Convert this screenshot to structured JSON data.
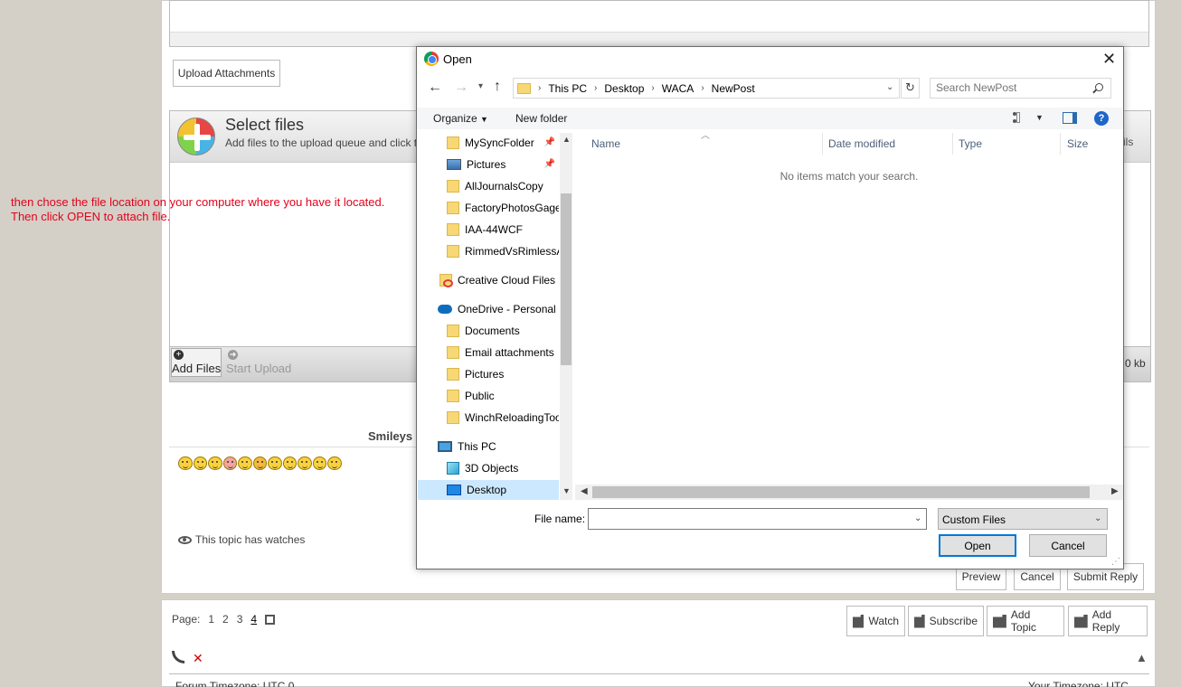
{
  "forum": {
    "upload_attachments": "Upload Attachments",
    "select_files_title": "Select files",
    "select_files_sub": "Add files to the upload queue and click t",
    "column_fragment": "ils",
    "add_files": "Add Files",
    "start_upload": "Start Upload",
    "kb_fragment": "0 kb",
    "instruction": "then chose the file location on your computer where you have it located. Then click OPEN to attach file.",
    "smileys_label": "Smileys",
    "watches_text": "This topic has watches",
    "preview": "Preview",
    "cancel": "Cancel",
    "submit_reply": "Submit Reply",
    "page_label": "Page:",
    "pages": [
      "1",
      "2",
      "3",
      "4"
    ],
    "current_page": "4",
    "tools": {
      "watch": "Watch",
      "subscribe": "Subscribe",
      "add_topic": "Add Topic",
      "add_reply": "Add Reply"
    },
    "forum_timezone": "Forum Timezone: UTC 0",
    "your_timezone": "Your Timezone: UTC"
  },
  "dialog": {
    "title": "Open",
    "breadcrumbs": [
      "This PC",
      "Desktop",
      "WACA",
      "NewPost"
    ],
    "search_placeholder": "Search NewPost",
    "organize": "Organize",
    "new_folder": "New folder",
    "tree": [
      {
        "label": "MySyncFolder",
        "icon": "folder-icon",
        "pinned": true
      },
      {
        "label": "Pictures",
        "icon": "pictures-icon",
        "pinned": true
      },
      {
        "label": "AllJournalsCopy",
        "icon": "folder-icon"
      },
      {
        "label": "FactoryPhotosGage",
        "icon": "folder-icon"
      },
      {
        "label": "IAA-44WCF",
        "icon": "folder-icon"
      },
      {
        "label": "RimmedVsRimlessA",
        "icon": "folder-icon"
      },
      {
        "label": "Creative Cloud Files",
        "icon": "creative-cloud-icon"
      },
      {
        "label": "OneDrive - Personal",
        "icon": "onedrive-icon"
      },
      {
        "label": "Documents",
        "icon": "folder-icon"
      },
      {
        "label": "Email attachments",
        "icon": "folder-icon"
      },
      {
        "label": "Pictures",
        "icon": "folder-icon"
      },
      {
        "label": "Public",
        "icon": "folder-icon"
      },
      {
        "label": "WinchReloadingToo",
        "icon": "folder-icon"
      },
      {
        "label": "This PC",
        "icon": "this-pc-icon"
      },
      {
        "label": "3D Objects",
        "icon": "3d-objects-icon"
      },
      {
        "label": "Desktop",
        "icon": "desktop-icon",
        "selected": true
      }
    ],
    "columns": [
      "Name",
      "Date modified",
      "Type",
      "Size"
    ],
    "empty_message": "No items match your search.",
    "file_name_label": "File name:",
    "file_name_value": "",
    "file_type": "Custom Files",
    "open": "Open",
    "cancel": "Cancel"
  }
}
